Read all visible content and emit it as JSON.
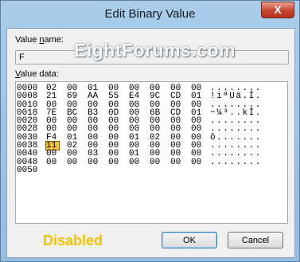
{
  "window": {
    "title": "Edit Binary Value",
    "close_glyph": "X"
  },
  "value_name": {
    "label_prefix": "Value ",
    "label_accel": "n",
    "label_suffix": "ame:",
    "value": "F"
  },
  "value_data": {
    "label_prefix": "",
    "label_accel": "V",
    "label_suffix": "alue data:",
    "rows": [
      {
        "addr": "0000",
        "bytes": [
          "02",
          "00",
          "01",
          "00",
          "00",
          "00",
          "00",
          "00"
        ],
        "ascii": "........"
      },
      {
        "addr": "0008",
        "bytes": [
          "21",
          "69",
          "AA",
          "55",
          "E4",
          "9C",
          "CD",
          "01"
        ],
        "ascii": "!iªUä.Í."
      },
      {
        "addr": "0010",
        "bytes": [
          "00",
          "00",
          "00",
          "00",
          "00",
          "00",
          "00",
          "00"
        ],
        "ascii": "........"
      },
      {
        "addr": "0018",
        "bytes": [
          "7E",
          "BC",
          "B3",
          "0D",
          "00",
          "6B",
          "CD",
          "01"
        ],
        "ascii": "~¼³..kÍ."
      },
      {
        "addr": "0020",
        "bytes": [
          "00",
          "00",
          "00",
          "00",
          "00",
          "00",
          "00",
          "00"
        ],
        "ascii": "........"
      },
      {
        "addr": "0028",
        "bytes": [
          "00",
          "00",
          "00",
          "00",
          "00",
          "00",
          "00",
          "00"
        ],
        "ascii": "........"
      },
      {
        "addr": "0030",
        "bytes": [
          "F4",
          "01",
          "00",
          "00",
          "01",
          "02",
          "00",
          "00"
        ],
        "ascii": "ô......."
      },
      {
        "addr": "0038",
        "bytes": [
          "11",
          "02",
          "00",
          "00",
          "00",
          "00",
          "00",
          "00"
        ],
        "ascii": "........"
      },
      {
        "addr": "0040",
        "bytes": [
          "00",
          "00",
          "03",
          "00",
          "01",
          "00",
          "00",
          "00"
        ],
        "ascii": "........"
      },
      {
        "addr": "0048",
        "bytes": [
          "00",
          "00",
          "00",
          "00",
          "00",
          "00",
          "00",
          "00"
        ],
        "ascii": "........"
      },
      {
        "addr": "0050",
        "bytes": [],
        "ascii": ""
      }
    ]
  },
  "watermark": "EightForums.com",
  "overlay_label": "Disabled",
  "buttons": {
    "ok": "OK",
    "cancel": "Cancel"
  }
}
